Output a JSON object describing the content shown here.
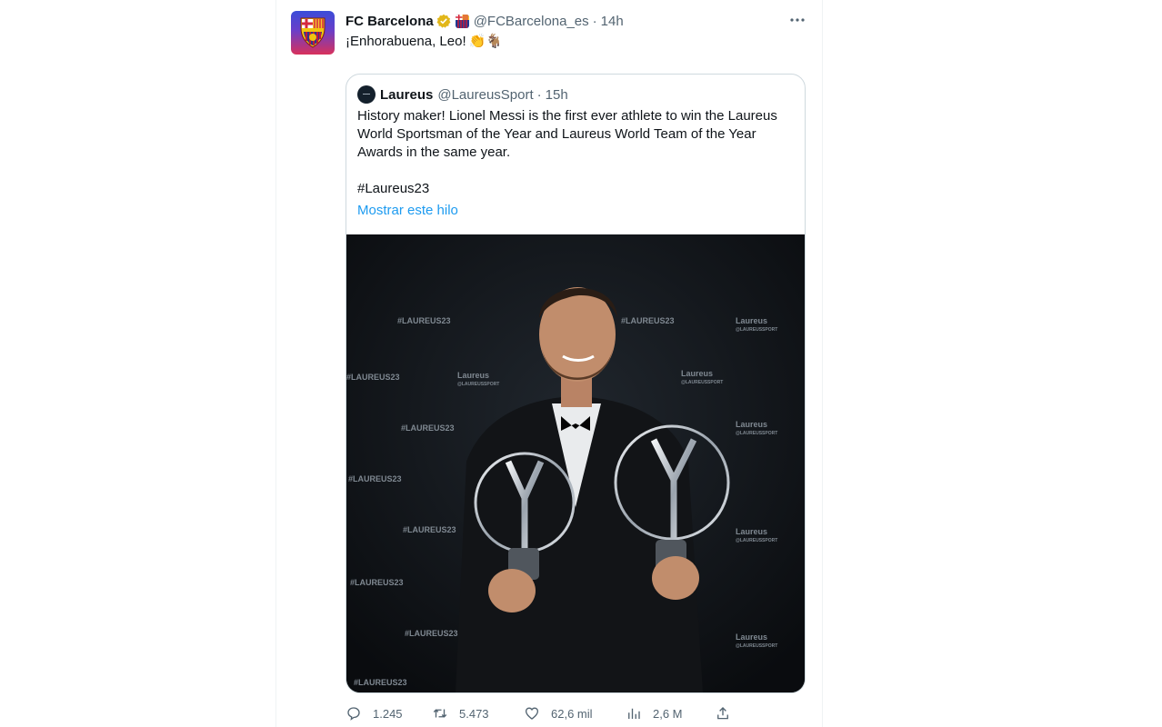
{
  "author": {
    "name": "FC Barcelona",
    "handle": "@FCBarcelona_es",
    "time": "14h",
    "avatar_icon": "fcb-crest-icon",
    "verified_badge": "gold-verified-badge-icon",
    "affiliate_icon": "fcb-flag-icon"
  },
  "tweet": {
    "text": "¡Enhorabuena, Leo!",
    "emojis": "👏🐐"
  },
  "quote": {
    "name": "Laureus",
    "handle": "@LaureusSport",
    "time": "15h",
    "text": "History maker! Lionel Messi is the first ever athlete to win the Laureus World Sportsman of the Year and Laureus World Team of the Year Awards in the same year.\n\n#Laureus23",
    "show_thread": "Mostrar este hilo",
    "photo": {
      "backdrop_labels": [
        "#LAUREUS23",
        "Laureus",
        "@LAUREUSSPORT"
      ]
    }
  },
  "actions": {
    "replies": "1.245",
    "reposts": "5.473",
    "likes": "62,6 mil",
    "views": "2,6 M"
  },
  "colors": {
    "link": "#1d9bf0",
    "muted": "#536471",
    "border": "#cfd9de",
    "text": "#0f1419"
  }
}
